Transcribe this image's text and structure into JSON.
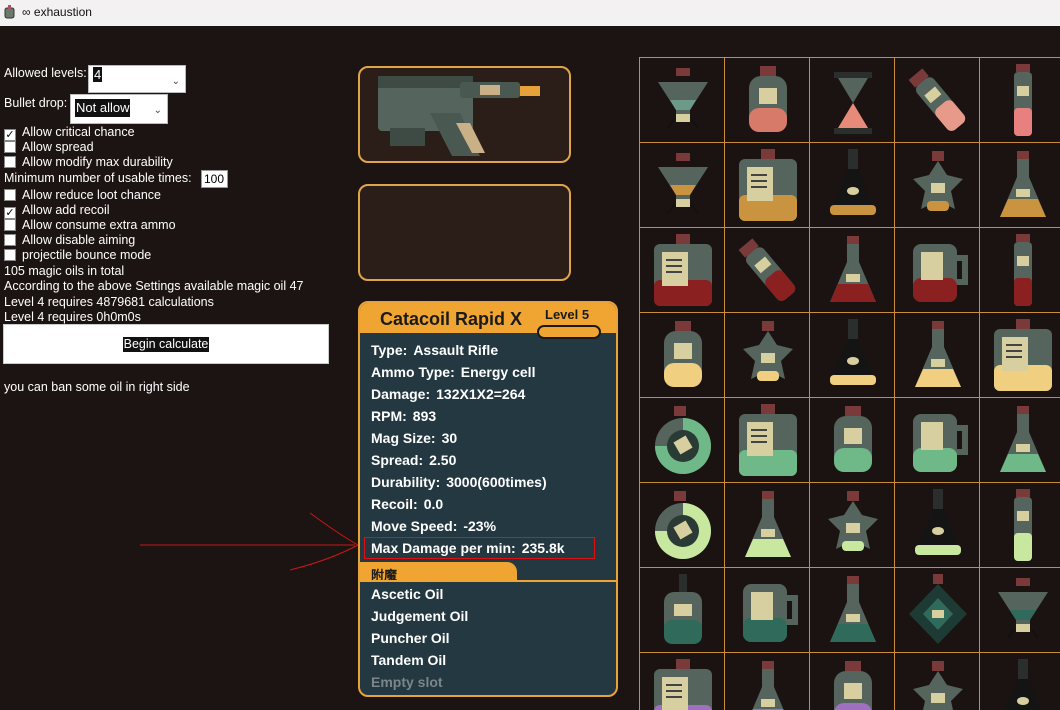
{
  "window": {
    "title": "∞ exhaustion"
  },
  "settings": {
    "allowed_levels_label": "Allowed levels:",
    "allowed_levels_value": "4",
    "bullet_drop_label": "Bullet drop:",
    "bullet_drop_value": "Not allow",
    "checkboxes": [
      {
        "label": "Allow critical chance",
        "checked": true
      },
      {
        "label": "Allow spread",
        "checked": false
      },
      {
        "label": "Allow modify max durability",
        "checked": false
      }
    ],
    "min_usable_label": "Minimum number of usable times:",
    "min_usable_value": "100",
    "checkboxes2": [
      {
        "label": "Allow reduce loot chance",
        "checked": false
      },
      {
        "label": "Allow add recoil",
        "checked": true
      },
      {
        "label": "Allow consume extra ammo",
        "checked": false
      },
      {
        "label": "Allow disable aiming",
        "checked": false
      },
      {
        "label": "projectile bounce mode",
        "checked": false
      }
    ],
    "info_total": " 105 magic oils in total",
    "info_available": "According to the above Settings available magic oil 47",
    "info_calcs": "Level 4 requires 4879681 calculations",
    "info_time": "Level 4 requires 0h0m0s",
    "calc_button": "Begin calculate",
    "ban_hint": "you can ban some oil in right side"
  },
  "weapon": {
    "name": "Catacoil Rapid X",
    "level": "Level 5",
    "stats": [
      {
        "key": "Type:",
        "value": "Assault Rifle"
      },
      {
        "key": "Ammo Type:",
        "value": "Energy cell"
      },
      {
        "key": "Damage:",
        "value": "132X1X2=264"
      },
      {
        "key": "RPM:",
        "value": "893"
      },
      {
        "key": "Mag Size:",
        "value": "30"
      },
      {
        "key": "Spread:",
        "value": "2.50"
      },
      {
        "key": "Durability:",
        "value": "3000(600times)"
      },
      {
        "key": "Recoil:",
        "value": "0.0"
      },
      {
        "key": "Move Speed:",
        "value": "-23%"
      },
      {
        "key": "Max Damage per min:",
        "value": "235.8k"
      }
    ],
    "enchant_label": "附魔",
    "oils": [
      "Ascetic Oil",
      "Judgement Oil",
      "Puncher Oil",
      "Tandem Oil"
    ],
    "empty_slot": "Empty slot"
  },
  "colors": {
    "accent": "#f0a532",
    "card_bg": "#243841",
    "page_bg": "#1c1412",
    "grid_border": "#c98c3a"
  },
  "oil_grid": {
    "columns": 5,
    "items": [
      {
        "icon": "triangle-flask-icon",
        "liquid": "#6b9a8a"
      },
      {
        "icon": "round-jar-icon",
        "liquid": "#d77a6a"
      },
      {
        "icon": "hourglass-icon",
        "liquid": "#e88a7a"
      },
      {
        "icon": "vial-icon",
        "liquid": "#e89a8a"
      },
      {
        "icon": "tube-icon",
        "liquid": "#e88080"
      },
      {
        "icon": "triangle-flask-icon",
        "liquid": "#c9933f"
      },
      {
        "icon": "square-bottle-icon",
        "liquid": "#c9933f"
      },
      {
        "icon": "dark-flask-icon",
        "liquid": "#c9933f"
      },
      {
        "icon": "star-bottle-icon",
        "liquid": "#c9933f"
      },
      {
        "icon": "flask-icon",
        "liquid": "#c9933f"
      },
      {
        "icon": "square-bottle-icon",
        "liquid": "#8a2020"
      },
      {
        "icon": "vial-icon",
        "liquid": "#8a2020"
      },
      {
        "icon": "flask-icon",
        "liquid": "#8a2020"
      },
      {
        "icon": "mug-icon",
        "liquid": "#8a2020"
      },
      {
        "icon": "tube-icon",
        "liquid": "#8a2020"
      },
      {
        "icon": "round-jar-icon",
        "liquid": "#f0d080"
      },
      {
        "icon": "star-bottle-icon",
        "liquid": "#f0d080"
      },
      {
        "icon": "dark-flask-icon",
        "liquid": "#f0d080"
      },
      {
        "icon": "flask-icon",
        "liquid": "#f0d080"
      },
      {
        "icon": "square-bottle-icon",
        "liquid": "#f0d080"
      },
      {
        "icon": "round-flask-icon",
        "liquid": "#6fb888"
      },
      {
        "icon": "square-bottle-icon",
        "liquid": "#6fb888"
      },
      {
        "icon": "round-jar-icon",
        "liquid": "#6fb888"
      },
      {
        "icon": "mug-icon",
        "liquid": "#6fb888"
      },
      {
        "icon": "flask-icon",
        "liquid": "#6fb888"
      },
      {
        "icon": "round-flask-icon",
        "liquid": "#c8e8a0"
      },
      {
        "icon": "flask-icon",
        "liquid": "#c8e8a0"
      },
      {
        "icon": "star-bottle-icon",
        "liquid": "#c8e8a0"
      },
      {
        "icon": "dark-flask-icon",
        "liquid": "#c8e8a0"
      },
      {
        "icon": "tube-icon",
        "liquid": "#c8e8a0"
      },
      {
        "icon": "dropper-icon",
        "liquid": "#2f6a5a"
      },
      {
        "icon": "mug-icon",
        "liquid": "#2f6a5a"
      },
      {
        "icon": "flask-icon",
        "liquid": "#2f6a5a"
      },
      {
        "icon": "diamond-bottle-icon",
        "liquid": "#2f6a5a"
      },
      {
        "icon": "triangle-flask-icon",
        "liquid": "#2f6a5a"
      },
      {
        "icon": "square-bottle-icon",
        "liquid": "#a070c0"
      },
      {
        "icon": "flask-icon",
        "liquid": "#a070c0"
      },
      {
        "icon": "round-jar-icon",
        "liquid": "#a070c0"
      },
      {
        "icon": "star-bottle-icon",
        "liquid": "#a070c0"
      },
      {
        "icon": "dark-flask-icon",
        "liquid": "#a070c0"
      }
    ]
  }
}
